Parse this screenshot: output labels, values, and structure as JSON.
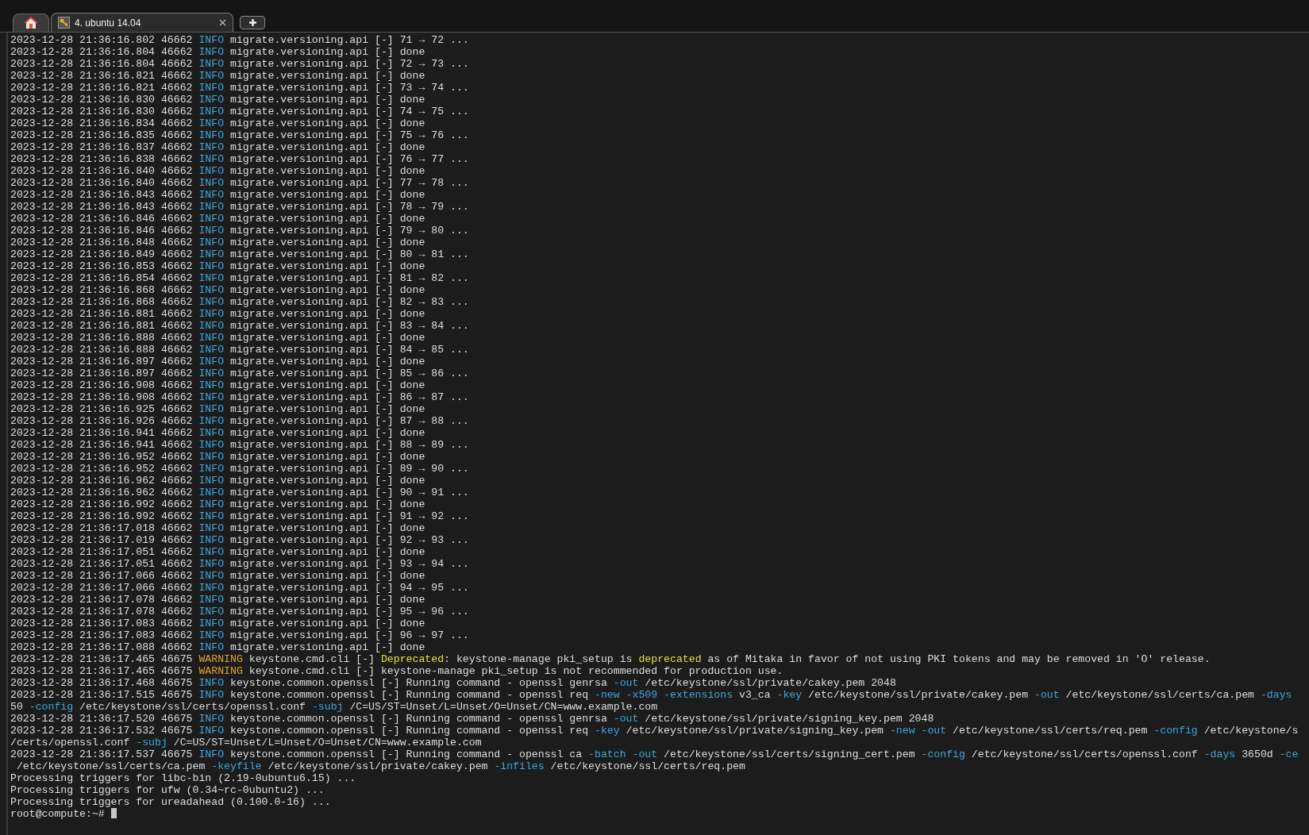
{
  "tabs": [
    {
      "kind": "home",
      "selected": false
    },
    {
      "kind": "session",
      "label": "4. ubuntu 14.04",
      "selected": true
    }
  ],
  "lines": [
    {
      "segments": [
        {
          "kind": "plain",
          "text": "2023-12-28 21:36:16.802 46662 "
        },
        {
          "kind": "info",
          "text": "INFO"
        },
        {
          "kind": "plain",
          "text": " migrate.versioning.api [-] 71 → 72 ..."
        }
      ]
    },
    {
      "segments": [
        {
          "kind": "plain",
          "text": "2023-12-28 21:36:16.804 46662 "
        },
        {
          "kind": "info",
          "text": "INFO"
        },
        {
          "kind": "plain",
          "text": " migrate.versioning.api [-] done"
        }
      ]
    },
    {
      "segments": [
        {
          "kind": "plain",
          "text": "2023-12-28 21:36:16.804 46662 "
        },
        {
          "kind": "info",
          "text": "INFO"
        },
        {
          "kind": "plain",
          "text": " migrate.versioning.api [-] 72 → 73 ..."
        }
      ]
    },
    {
      "segments": [
        {
          "kind": "plain",
          "text": "2023-12-28 21:36:16.821 46662 "
        },
        {
          "kind": "info",
          "text": "INFO"
        },
        {
          "kind": "plain",
          "text": " migrate.versioning.api [-] done"
        }
      ]
    },
    {
      "segments": [
        {
          "kind": "plain",
          "text": "2023-12-28 21:36:16.821 46662 "
        },
        {
          "kind": "info",
          "text": "INFO"
        },
        {
          "kind": "plain",
          "text": " migrate.versioning.api [-] 73 → 74 ..."
        }
      ]
    },
    {
      "segments": [
        {
          "kind": "plain",
          "text": "2023-12-28 21:36:16.830 46662 "
        },
        {
          "kind": "info",
          "text": "INFO"
        },
        {
          "kind": "plain",
          "text": " migrate.versioning.api [-] done"
        }
      ]
    },
    {
      "segments": [
        {
          "kind": "plain",
          "text": "2023-12-28 21:36:16.830 46662 "
        },
        {
          "kind": "info",
          "text": "INFO"
        },
        {
          "kind": "plain",
          "text": " migrate.versioning.api [-] 74 → 75 ..."
        }
      ]
    },
    {
      "segments": [
        {
          "kind": "plain",
          "text": "2023-12-28 21:36:16.834 46662 "
        },
        {
          "kind": "info",
          "text": "INFO"
        },
        {
          "kind": "plain",
          "text": " migrate.versioning.api [-] done"
        }
      ]
    },
    {
      "segments": [
        {
          "kind": "plain",
          "text": "2023-12-28 21:36:16.835 46662 "
        },
        {
          "kind": "info",
          "text": "INFO"
        },
        {
          "kind": "plain",
          "text": " migrate.versioning.api [-] 75 → 76 ..."
        }
      ]
    },
    {
      "segments": [
        {
          "kind": "plain",
          "text": "2023-12-28 21:36:16.837 46662 "
        },
        {
          "kind": "info",
          "text": "INFO"
        },
        {
          "kind": "plain",
          "text": " migrate.versioning.api [-] done"
        }
      ]
    },
    {
      "segments": [
        {
          "kind": "plain",
          "text": "2023-12-28 21:36:16.838 46662 "
        },
        {
          "kind": "info",
          "text": "INFO"
        },
        {
          "kind": "plain",
          "text": " migrate.versioning.api [-] 76 → 77 ..."
        }
      ]
    },
    {
      "segments": [
        {
          "kind": "plain",
          "text": "2023-12-28 21:36:16.840 46662 "
        },
        {
          "kind": "info",
          "text": "INFO"
        },
        {
          "kind": "plain",
          "text": " migrate.versioning.api [-] done"
        }
      ]
    },
    {
      "segments": [
        {
          "kind": "plain",
          "text": "2023-12-28 21:36:16.840 46662 "
        },
        {
          "kind": "info",
          "text": "INFO"
        },
        {
          "kind": "plain",
          "text": " migrate.versioning.api [-] 77 → 78 ..."
        }
      ]
    },
    {
      "segments": [
        {
          "kind": "plain",
          "text": "2023-12-28 21:36:16.843 46662 "
        },
        {
          "kind": "info",
          "text": "INFO"
        },
        {
          "kind": "plain",
          "text": " migrate.versioning.api [-] done"
        }
      ]
    },
    {
      "segments": [
        {
          "kind": "plain",
          "text": "2023-12-28 21:36:16.843 46662 "
        },
        {
          "kind": "info",
          "text": "INFO"
        },
        {
          "kind": "plain",
          "text": " migrate.versioning.api [-] 78 → 79 ..."
        }
      ]
    },
    {
      "segments": [
        {
          "kind": "plain",
          "text": "2023-12-28 21:36:16.846 46662 "
        },
        {
          "kind": "info",
          "text": "INFO"
        },
        {
          "kind": "plain",
          "text": " migrate.versioning.api [-] done"
        }
      ]
    },
    {
      "segments": [
        {
          "kind": "plain",
          "text": "2023-12-28 21:36:16.846 46662 "
        },
        {
          "kind": "info",
          "text": "INFO"
        },
        {
          "kind": "plain",
          "text": " migrate.versioning.api [-] 79 → 80 ..."
        }
      ]
    },
    {
      "segments": [
        {
          "kind": "plain",
          "text": "2023-12-28 21:36:16.848 46662 "
        },
        {
          "kind": "info",
          "text": "INFO"
        },
        {
          "kind": "plain",
          "text": " migrate.versioning.api [-] done"
        }
      ]
    },
    {
      "segments": [
        {
          "kind": "plain",
          "text": "2023-12-28 21:36:16.849 46662 "
        },
        {
          "kind": "info",
          "text": "INFO"
        },
        {
          "kind": "plain",
          "text": " migrate.versioning.api [-] 80 → 81 ..."
        }
      ]
    },
    {
      "segments": [
        {
          "kind": "plain",
          "text": "2023-12-28 21:36:16.853 46662 "
        },
        {
          "kind": "info",
          "text": "INFO"
        },
        {
          "kind": "plain",
          "text": " migrate.versioning.api [-] done"
        }
      ]
    },
    {
      "segments": [
        {
          "kind": "plain",
          "text": "2023-12-28 21:36:16.854 46662 "
        },
        {
          "kind": "info",
          "text": "INFO"
        },
        {
          "kind": "plain",
          "text": " migrate.versioning.api [-] 81 → 82 ..."
        }
      ]
    },
    {
      "segments": [
        {
          "kind": "plain",
          "text": "2023-12-28 21:36:16.868 46662 "
        },
        {
          "kind": "info",
          "text": "INFO"
        },
        {
          "kind": "plain",
          "text": " migrate.versioning.api [-] done"
        }
      ]
    },
    {
      "segments": [
        {
          "kind": "plain",
          "text": "2023-12-28 21:36:16.868 46662 "
        },
        {
          "kind": "info",
          "text": "INFO"
        },
        {
          "kind": "plain",
          "text": " migrate.versioning.api [-] 82 → 83 ..."
        }
      ]
    },
    {
      "segments": [
        {
          "kind": "plain",
          "text": "2023-12-28 21:36:16.881 46662 "
        },
        {
          "kind": "info",
          "text": "INFO"
        },
        {
          "kind": "plain",
          "text": " migrate.versioning.api [-] done"
        }
      ]
    },
    {
      "segments": [
        {
          "kind": "plain",
          "text": "2023-12-28 21:36:16.881 46662 "
        },
        {
          "kind": "info",
          "text": "INFO"
        },
        {
          "kind": "plain",
          "text": " migrate.versioning.api [-] 83 → 84 ..."
        }
      ]
    },
    {
      "segments": [
        {
          "kind": "plain",
          "text": "2023-12-28 21:36:16.888 46662 "
        },
        {
          "kind": "info",
          "text": "INFO"
        },
        {
          "kind": "plain",
          "text": " migrate.versioning.api [-] done"
        }
      ]
    },
    {
      "segments": [
        {
          "kind": "plain",
          "text": "2023-12-28 21:36:16.888 46662 "
        },
        {
          "kind": "info",
          "text": "INFO"
        },
        {
          "kind": "plain",
          "text": " migrate.versioning.api [-] 84 → 85 ..."
        }
      ]
    },
    {
      "segments": [
        {
          "kind": "plain",
          "text": "2023-12-28 21:36:16.897 46662 "
        },
        {
          "kind": "info",
          "text": "INFO"
        },
        {
          "kind": "plain",
          "text": " migrate.versioning.api [-] done"
        }
      ]
    },
    {
      "segments": [
        {
          "kind": "plain",
          "text": "2023-12-28 21:36:16.897 46662 "
        },
        {
          "kind": "info",
          "text": "INFO"
        },
        {
          "kind": "plain",
          "text": " migrate.versioning.api [-] 85 → 86 ..."
        }
      ]
    },
    {
      "segments": [
        {
          "kind": "plain",
          "text": "2023-12-28 21:36:16.908 46662 "
        },
        {
          "kind": "info",
          "text": "INFO"
        },
        {
          "kind": "plain",
          "text": " migrate.versioning.api [-] done"
        }
      ]
    },
    {
      "segments": [
        {
          "kind": "plain",
          "text": "2023-12-28 21:36:16.908 46662 "
        },
        {
          "kind": "info",
          "text": "INFO"
        },
        {
          "kind": "plain",
          "text": " migrate.versioning.api [-] 86 → 87 ..."
        }
      ]
    },
    {
      "segments": [
        {
          "kind": "plain",
          "text": "2023-12-28 21:36:16.925 46662 "
        },
        {
          "kind": "info",
          "text": "INFO"
        },
        {
          "kind": "plain",
          "text": " migrate.versioning.api [-] done"
        }
      ]
    },
    {
      "segments": [
        {
          "kind": "plain",
          "text": "2023-12-28 21:36:16.926 46662 "
        },
        {
          "kind": "info",
          "text": "INFO"
        },
        {
          "kind": "plain",
          "text": " migrate.versioning.api [-] 87 → 88 ..."
        }
      ]
    },
    {
      "segments": [
        {
          "kind": "plain",
          "text": "2023-12-28 21:36:16.941 46662 "
        },
        {
          "kind": "info",
          "text": "INFO"
        },
        {
          "kind": "plain",
          "text": " migrate.versioning.api [-] done"
        }
      ]
    },
    {
      "segments": [
        {
          "kind": "plain",
          "text": "2023-12-28 21:36:16.941 46662 "
        },
        {
          "kind": "info",
          "text": "INFO"
        },
        {
          "kind": "plain",
          "text": " migrate.versioning.api [-] 88 → 89 ..."
        }
      ]
    },
    {
      "segments": [
        {
          "kind": "plain",
          "text": "2023-12-28 21:36:16.952 46662 "
        },
        {
          "kind": "info",
          "text": "INFO"
        },
        {
          "kind": "plain",
          "text": " migrate.versioning.api [-] done"
        }
      ]
    },
    {
      "segments": [
        {
          "kind": "plain",
          "text": "2023-12-28 21:36:16.952 46662 "
        },
        {
          "kind": "info",
          "text": "INFO"
        },
        {
          "kind": "plain",
          "text": " migrate.versioning.api [-] 89 → 90 ..."
        }
      ]
    },
    {
      "segments": [
        {
          "kind": "plain",
          "text": "2023-12-28 21:36:16.962 46662 "
        },
        {
          "kind": "info",
          "text": "INFO"
        },
        {
          "kind": "plain",
          "text": " migrate.versioning.api [-] done"
        }
      ]
    },
    {
      "segments": [
        {
          "kind": "plain",
          "text": "2023-12-28 21:36:16.962 46662 "
        },
        {
          "kind": "info",
          "text": "INFO"
        },
        {
          "kind": "plain",
          "text": " migrate.versioning.api [-] 90 → 91 ..."
        }
      ]
    },
    {
      "segments": [
        {
          "kind": "plain",
          "text": "2023-12-28 21:36:16.992 46662 "
        },
        {
          "kind": "info",
          "text": "INFO"
        },
        {
          "kind": "plain",
          "text": " migrate.versioning.api [-] done"
        }
      ]
    },
    {
      "segments": [
        {
          "kind": "plain",
          "text": "2023-12-28 21:36:16.992 46662 "
        },
        {
          "kind": "info",
          "text": "INFO"
        },
        {
          "kind": "plain",
          "text": " migrate.versioning.api [-] 91 → 92 ..."
        }
      ]
    },
    {
      "segments": [
        {
          "kind": "plain",
          "text": "2023-12-28 21:36:17.018 46662 "
        },
        {
          "kind": "info",
          "text": "INFO"
        },
        {
          "kind": "plain",
          "text": " migrate.versioning.api [-] done"
        }
      ]
    },
    {
      "segments": [
        {
          "kind": "plain",
          "text": "2023-12-28 21:36:17.019 46662 "
        },
        {
          "kind": "info",
          "text": "INFO"
        },
        {
          "kind": "plain",
          "text": " migrate.versioning.api [-] 92 → 93 ..."
        }
      ]
    },
    {
      "segments": [
        {
          "kind": "plain",
          "text": "2023-12-28 21:36:17.051 46662 "
        },
        {
          "kind": "info",
          "text": "INFO"
        },
        {
          "kind": "plain",
          "text": " migrate.versioning.api [-] done"
        }
      ]
    },
    {
      "segments": [
        {
          "kind": "plain",
          "text": "2023-12-28 21:36:17.051 46662 "
        },
        {
          "kind": "info",
          "text": "INFO"
        },
        {
          "kind": "plain",
          "text": " migrate.versioning.api [-] 93 → 94 ..."
        }
      ]
    },
    {
      "segments": [
        {
          "kind": "plain",
          "text": "2023-12-28 21:36:17.066 46662 "
        },
        {
          "kind": "info",
          "text": "INFO"
        },
        {
          "kind": "plain",
          "text": " migrate.versioning.api [-] done"
        }
      ]
    },
    {
      "segments": [
        {
          "kind": "plain",
          "text": "2023-12-28 21:36:17.066 46662 "
        },
        {
          "kind": "info",
          "text": "INFO"
        },
        {
          "kind": "plain",
          "text": " migrate.versioning.api [-] 94 → 95 ..."
        }
      ]
    },
    {
      "segments": [
        {
          "kind": "plain",
          "text": "2023-12-28 21:36:17.078 46662 "
        },
        {
          "kind": "info",
          "text": "INFO"
        },
        {
          "kind": "plain",
          "text": " migrate.versioning.api [-] done"
        }
      ]
    },
    {
      "segments": [
        {
          "kind": "plain",
          "text": "2023-12-28 21:36:17.078 46662 "
        },
        {
          "kind": "info",
          "text": "INFO"
        },
        {
          "kind": "plain",
          "text": " migrate.versioning.api [-] 95 → 96 ..."
        }
      ]
    },
    {
      "segments": [
        {
          "kind": "plain",
          "text": "2023-12-28 21:36:17.083 46662 "
        },
        {
          "kind": "info",
          "text": "INFO"
        },
        {
          "kind": "plain",
          "text": " migrate.versioning.api [-] done"
        }
      ]
    },
    {
      "segments": [
        {
          "kind": "plain",
          "text": "2023-12-28 21:36:17.083 46662 "
        },
        {
          "kind": "info",
          "text": "INFO"
        },
        {
          "kind": "plain",
          "text": " migrate.versioning.api [-] 96 → 97 ..."
        }
      ]
    },
    {
      "segments": [
        {
          "kind": "plain",
          "text": "2023-12-28 21:36:17.088 46662 "
        },
        {
          "kind": "info",
          "text": "INFO"
        },
        {
          "kind": "plain",
          "text": " migrate.versioning.api [-] done"
        }
      ]
    },
    {
      "segments": [
        {
          "kind": "plain",
          "text": "2023-12-28 21:36:17.465 46675 "
        },
        {
          "kind": "warning",
          "text": "WARNING"
        },
        {
          "kind": "plain",
          "text": " keystone.cmd.cli [-] "
        },
        {
          "kind": "highlight",
          "text": "Deprecated"
        },
        {
          "kind": "plain",
          "text": ": keystone-manage pki_setup is "
        },
        {
          "kind": "highlight",
          "text": "deprecated"
        },
        {
          "kind": "plain",
          "text": " as of Mitaka in favor of not using PKI tokens and may be removed in 'O' release."
        }
      ]
    },
    {
      "segments": [
        {
          "kind": "plain",
          "text": "2023-12-28 21:36:17.465 46675 "
        },
        {
          "kind": "warning",
          "text": "WARNING"
        },
        {
          "kind": "plain",
          "text": " keystone.cmd.cli [-] keystone-manage pki_setup is not recommended for production use."
        }
      ]
    },
    {
      "segments": [
        {
          "kind": "plain",
          "text": "2023-12-28 21:36:17.468 46675 "
        },
        {
          "kind": "info",
          "text": "INFO"
        },
        {
          "kind": "plain",
          "text": " keystone.common.openssl [-] Running command - openssl genrsa "
        },
        {
          "kind": "option",
          "text": "-out"
        },
        {
          "kind": "plain",
          "text": " /etc/keystone/ssl/private/cakey.pem 2048"
        }
      ]
    },
    {
      "segments": [
        {
          "kind": "plain",
          "text": "2023-12-28 21:36:17.515 46675 "
        },
        {
          "kind": "info",
          "text": "INFO"
        },
        {
          "kind": "plain",
          "text": " keystone.common.openssl [-] Running command - openssl req "
        },
        {
          "kind": "option",
          "text": "-new -x509 -extensions"
        },
        {
          "kind": "plain",
          "text": " v3_ca "
        },
        {
          "kind": "option",
          "text": "-key"
        },
        {
          "kind": "plain",
          "text": " /etc/keystone/ssl/private/cakey.pem "
        },
        {
          "kind": "option",
          "text": "-out"
        },
        {
          "kind": "plain",
          "text": " /etc/keystone/ssl/certs/ca.pem "
        },
        {
          "kind": "option",
          "text": "-days"
        }
      ]
    },
    {
      "segments": [
        {
          "kind": "plain",
          "text": "50 "
        },
        {
          "kind": "option",
          "text": "-config"
        },
        {
          "kind": "plain",
          "text": " /etc/keystone/ssl/certs/openssl.conf "
        },
        {
          "kind": "option",
          "text": "-subj"
        },
        {
          "kind": "plain",
          "text": " /C=US/ST=Unset/L=Unset/O=Unset/CN=www.example.com"
        }
      ]
    },
    {
      "segments": [
        {
          "kind": "plain",
          "text": "2023-12-28 21:36:17.520 46675 "
        },
        {
          "kind": "info",
          "text": "INFO"
        },
        {
          "kind": "plain",
          "text": " keystone.common.openssl [-] Running command - openssl genrsa "
        },
        {
          "kind": "option",
          "text": "-out"
        },
        {
          "kind": "plain",
          "text": " /etc/keystone/ssl/private/signing_key.pem 2048"
        }
      ]
    },
    {
      "segments": [
        {
          "kind": "plain",
          "text": "2023-12-28 21:36:17.532 46675 "
        },
        {
          "kind": "info",
          "text": "INFO"
        },
        {
          "kind": "plain",
          "text": " keystone.common.openssl [-] Running command - openssl req "
        },
        {
          "kind": "option",
          "text": "-key"
        },
        {
          "kind": "plain",
          "text": " /etc/keystone/ssl/private/signing_key.pem "
        },
        {
          "kind": "option",
          "text": "-new -out"
        },
        {
          "kind": "plain",
          "text": " /etc/keystone/ssl/certs/req.pem "
        },
        {
          "kind": "option",
          "text": "-config"
        },
        {
          "kind": "plain",
          "text": " /etc/keystone/s"
        }
      ]
    },
    {
      "segments": [
        {
          "kind": "plain",
          "text": "/certs/openssl.conf "
        },
        {
          "kind": "option",
          "text": "-subj"
        },
        {
          "kind": "plain",
          "text": " /C=US/ST=Unset/L=Unset/O=Unset/CN=www.example.com"
        }
      ]
    },
    {
      "segments": [
        {
          "kind": "plain",
          "text": "2023-12-28 21:36:17.537 46675 "
        },
        {
          "kind": "info",
          "text": "INFO"
        },
        {
          "kind": "plain",
          "text": " keystone.common.openssl [-] Running command - openssl ca "
        },
        {
          "kind": "option",
          "text": "-batch -out"
        },
        {
          "kind": "plain",
          "text": " /etc/keystone/ssl/certs/signing_cert.pem "
        },
        {
          "kind": "option",
          "text": "-config"
        },
        {
          "kind": "plain",
          "text": " /etc/keystone/ssl/certs/openssl.conf "
        },
        {
          "kind": "option",
          "text": "-days"
        },
        {
          "kind": "plain",
          "text": " 3650d "
        },
        {
          "kind": "option",
          "text": "-ce"
        }
      ]
    },
    {
      "segments": [
        {
          "kind": "plain",
          "text": " /etc/keystone/ssl/certs/ca.pem "
        },
        {
          "kind": "option",
          "text": "-keyfile"
        },
        {
          "kind": "plain",
          "text": " /etc/keystone/ssl/private/cakey.pem "
        },
        {
          "kind": "option",
          "text": "-infiles"
        },
        {
          "kind": "plain",
          "text": " /etc/keystone/ssl/certs/req.pem"
        }
      ]
    },
    {
      "segments": [
        {
          "kind": "plain",
          "text": "Processing triggers for libc-bin (2.19-0ubuntu6.15) ..."
        }
      ]
    },
    {
      "segments": [
        {
          "kind": "plain",
          "text": "Processing triggers for ufw (0.34~rc-0ubuntu2) ..."
        }
      ]
    },
    {
      "segments": [
        {
          "kind": "plain",
          "text": "Processing triggers for ureadahead (0.100.0-16) ..."
        }
      ]
    },
    {
      "segments": [
        {
          "kind": "plain",
          "text": "root@compute:~# "
        }
      ],
      "cursor": true
    }
  ]
}
